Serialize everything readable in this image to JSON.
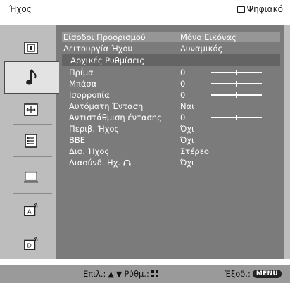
{
  "header": {
    "title": "Ήχος",
    "source_label": "Ψηφιακό"
  },
  "sidebar": {
    "items": [
      {
        "icon": "picture-icon",
        "selected": false
      },
      {
        "icon": "sound-note-icon",
        "selected": true
      },
      {
        "icon": "screen-fit-icon",
        "selected": false
      },
      {
        "icon": "settings-list-icon",
        "selected": false
      },
      {
        "icon": "pc-monitor-icon",
        "selected": false
      },
      {
        "icon": "analog-setup-icon",
        "selected": false
      },
      {
        "icon": "digital-setup-icon",
        "selected": false
      }
    ]
  },
  "menu": {
    "rows": [
      {
        "label": "Είσοδοι Προορισμού",
        "value": "Μόνο Εικόνας"
      },
      {
        "label": "Λειτουργία Ήχου",
        "value": "Δυναμικός"
      },
      {
        "label": "Αρχικές Ρυθμίσεις",
        "value": ""
      },
      {
        "label": "Πρίμα",
        "value": "0",
        "slider": 0.5
      },
      {
        "label": "Μπάσα",
        "value": "0",
        "slider": 0.5
      },
      {
        "label": "Ισορροπία",
        "value": "0",
        "slider": 0.5
      },
      {
        "label": "Αυτόματη Ένταση",
        "value": "Ναι"
      },
      {
        "label": "Αντιστάθμιση έντασης",
        "value": "0",
        "slider": 0.5
      },
      {
        "label": "Περιβ. Ήχος",
        "value": "Όχι"
      },
      {
        "label": "BBE",
        "value": "Όχι"
      },
      {
        "label": "Διφ. Ήχος",
        "value": "Στέρεο"
      },
      {
        "label": "Διασύνδ. Ηχ.",
        "value": "Όχι"
      }
    ]
  },
  "footer": {
    "select_label": "Επιλ.:",
    "adjust_label": "Ρύθμ.:",
    "exit_label": "Έξοδ.:",
    "menu_key": "MENU"
  },
  "colors": {
    "panel": "#7b7b7b",
    "sidebar": "#bdbdbd",
    "highlight": "#969696",
    "footer": "#9a9a9a"
  }
}
